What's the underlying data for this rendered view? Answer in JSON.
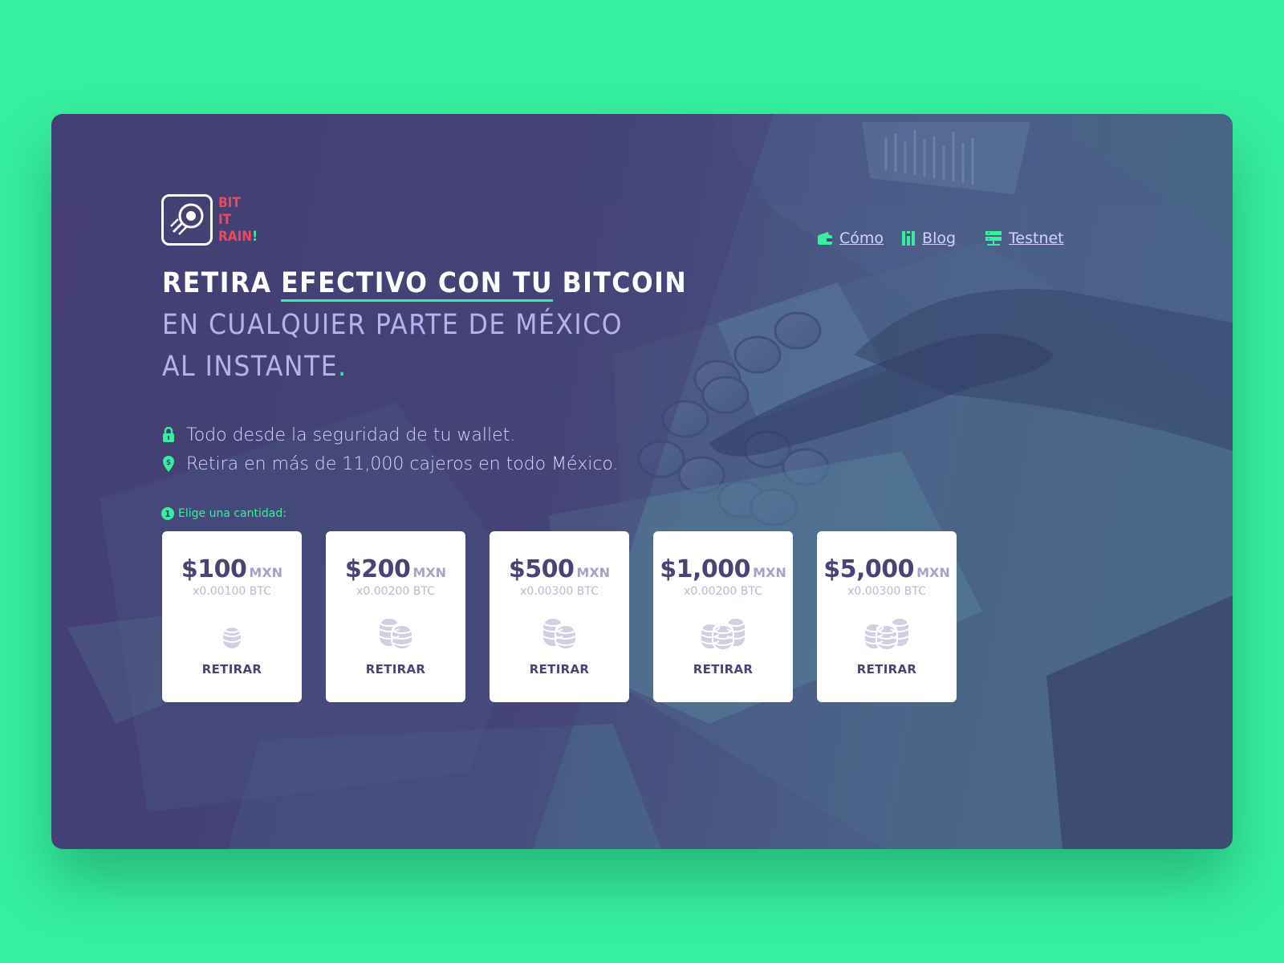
{
  "brand": {
    "line1": "BIT",
    "line2": "IT",
    "line3": "RAIN",
    "bang": "!"
  },
  "nav": {
    "items": [
      {
        "label": "Cómo",
        "icon": "wallet-icon"
      },
      {
        "label": "Blog",
        "icon": "book-icon"
      },
      {
        "label": "Testnet",
        "icon": "server-icon"
      }
    ]
  },
  "headline": {
    "w1": "RETIRA",
    "w2": "EFECTIVO CON TU",
    "w3": "BITCOIN",
    "line2": "EN CUALQUIER PARTE DE MÉXICO",
    "line3": "AL INSTANTE",
    "dot": "."
  },
  "features": [
    {
      "text": "Todo desde la seguridad de tu wallet.",
      "icon": "lock-icon"
    },
    {
      "text": "Retira en más de 11,000 cajeros en todo México.",
      "icon": "location-pin-icon"
    }
  ],
  "step": {
    "number": "1",
    "label": "Elige una cantidad:"
  },
  "cards": [
    {
      "amount": "$100",
      "currency": "MXN",
      "btc": "x0.00100 BTC",
      "action": "RETIRAR",
      "icon": "coin-stack-1-icon"
    },
    {
      "amount": "$200",
      "currency": "MXN",
      "btc": "x0.00200 BTC",
      "action": "RETIRAR",
      "icon": "coin-stack-2-icon"
    },
    {
      "amount": "$500",
      "currency": "MXN",
      "btc": "x0.00300 BTC",
      "action": "RETIRAR",
      "icon": "coin-stack-2-icon"
    },
    {
      "amount": "$1,000",
      "currency": "MXN",
      "btc": "x0.00200 BTC",
      "action": "RETIRAR",
      "icon": "coin-stack-3-icon"
    },
    {
      "amount": "$5,000",
      "currency": "MXN",
      "btc": "x0.00300 BTC",
      "action": "RETIRAR",
      "icon": "coin-stack-3-icon"
    }
  ],
  "colors": {
    "accent": "#36ef9f",
    "brand_red": "#f0475b",
    "panel": "#443f74",
    "card_text": "#4a4377"
  }
}
